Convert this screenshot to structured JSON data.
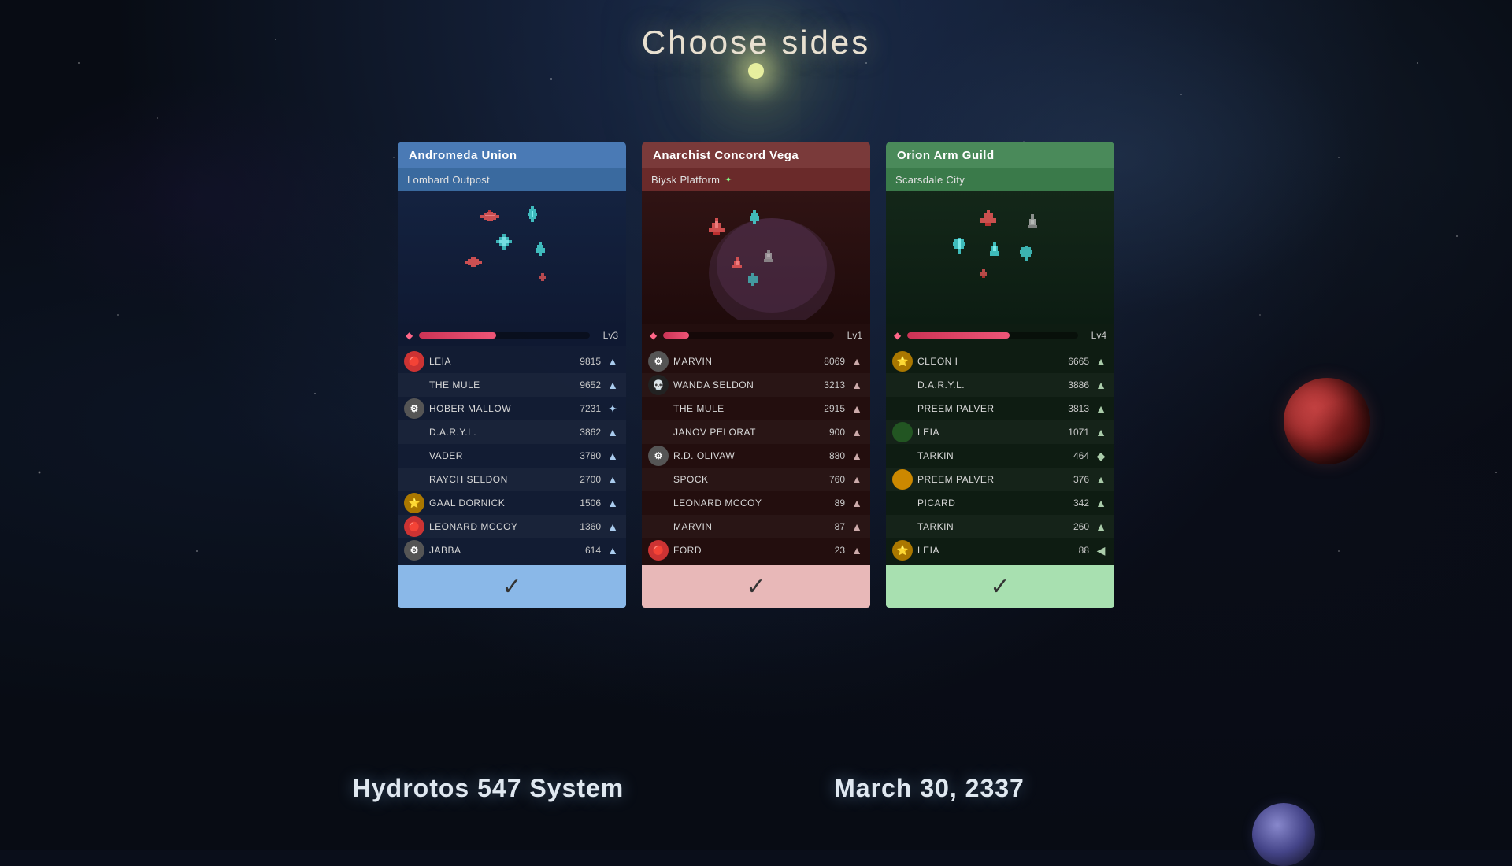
{
  "page": {
    "title": "Choose sides",
    "bottom_left": "Hydrotos 547 System",
    "bottom_right": "March 30, 2337"
  },
  "factions": [
    {
      "id": "andromeda",
      "name": "Andromeda Union",
      "subtitle": "Lombard Outpost",
      "level": "Lv3",
      "level_pct": 45,
      "confirm_label": "✓",
      "players": [
        {
          "name": "LEIA",
          "score": "9815",
          "avatar_color": "av-red",
          "has_avatar": true
        },
        {
          "name": "THE MULE",
          "score": "9652",
          "avatar_color": "av-none",
          "has_avatar": false
        },
        {
          "name": "HOBER MALLOW",
          "score": "7231",
          "avatar_color": "av-gray",
          "has_avatar": true
        },
        {
          "name": "D.A.R.Y.L.",
          "score": "3862",
          "avatar_color": "av-none",
          "has_avatar": false
        },
        {
          "name": "VADER",
          "score": "3780",
          "avatar_color": "av-none",
          "has_avatar": false
        },
        {
          "name": "RAYCH SELDON",
          "score": "2700",
          "avatar_color": "av-none",
          "has_avatar": false
        },
        {
          "name": "GAAL DORNICK",
          "score": "1506",
          "avatar_color": "badge-star",
          "has_avatar": true
        },
        {
          "name": "LEONARD MCCOY",
          "score": "1360",
          "avatar_color": "av-red",
          "has_avatar": true
        },
        {
          "name": "JABBA",
          "score": "614",
          "avatar_color": "av-gray",
          "has_avatar": true
        }
      ]
    },
    {
      "id": "anarchist",
      "name": "Anarchist Concord Vega",
      "subtitle": "Biysk Platform",
      "level": "Lv1",
      "level_pct": 15,
      "confirm_label": "✓",
      "players": [
        {
          "name": "MARVIN",
          "score": "8069",
          "avatar_color": "av-gray",
          "has_avatar": true
        },
        {
          "name": "WANDA SELDON",
          "score": "3213",
          "avatar_color": "av-dark",
          "has_avatar": true
        },
        {
          "name": "THE MULE",
          "score": "2915",
          "avatar_color": "av-none",
          "has_avatar": false
        },
        {
          "name": "JANOV PELORAT",
          "score": "900",
          "avatar_color": "av-none",
          "has_avatar": false
        },
        {
          "name": "R.D. OLIVAW",
          "score": "880",
          "avatar_color": "av-gray",
          "has_avatar": true
        },
        {
          "name": "SPOCK",
          "score": "760",
          "avatar_color": "av-none",
          "has_avatar": false
        },
        {
          "name": "LEONARD MCCOY",
          "score": "89",
          "avatar_color": "av-none",
          "has_avatar": false
        },
        {
          "name": "MARVIN",
          "score": "87",
          "avatar_color": "av-none",
          "has_avatar": false
        },
        {
          "name": "FORD",
          "score": "23",
          "avatar_color": "av-red",
          "has_avatar": true
        }
      ]
    },
    {
      "id": "orion",
      "name": "Orion Arm Guild",
      "subtitle": "Scarsdale City",
      "level": "Lv4",
      "level_pct": 60,
      "confirm_label": "✓",
      "players": [
        {
          "name": "CLEON I",
          "score": "6665",
          "avatar_color": "badge-star",
          "has_avatar": true
        },
        {
          "name": "D.A.R.Y.L.",
          "score": "3886",
          "avatar_color": "av-none",
          "has_avatar": false
        },
        {
          "name": "PREEM PALVER",
          "score": "3813",
          "avatar_color": "av-none",
          "has_avatar": false
        },
        {
          "name": "LEIA",
          "score": "1071",
          "avatar_color": "av-green",
          "has_avatar": true
        },
        {
          "name": "TARKIN",
          "score": "464",
          "avatar_color": "av-none",
          "has_avatar": false
        },
        {
          "name": "PREEM PALVER",
          "score": "376",
          "avatar_color": "av-gold",
          "has_avatar": true
        },
        {
          "name": "PICARD",
          "score": "342",
          "avatar_color": "av-none",
          "has_avatar": false
        },
        {
          "name": "TARKIN",
          "score": "260",
          "avatar_color": "av-none",
          "has_avatar": false
        },
        {
          "name": "LEIA",
          "score": "88",
          "avatar_color": "badge-star",
          "has_avatar": true
        }
      ]
    }
  ]
}
